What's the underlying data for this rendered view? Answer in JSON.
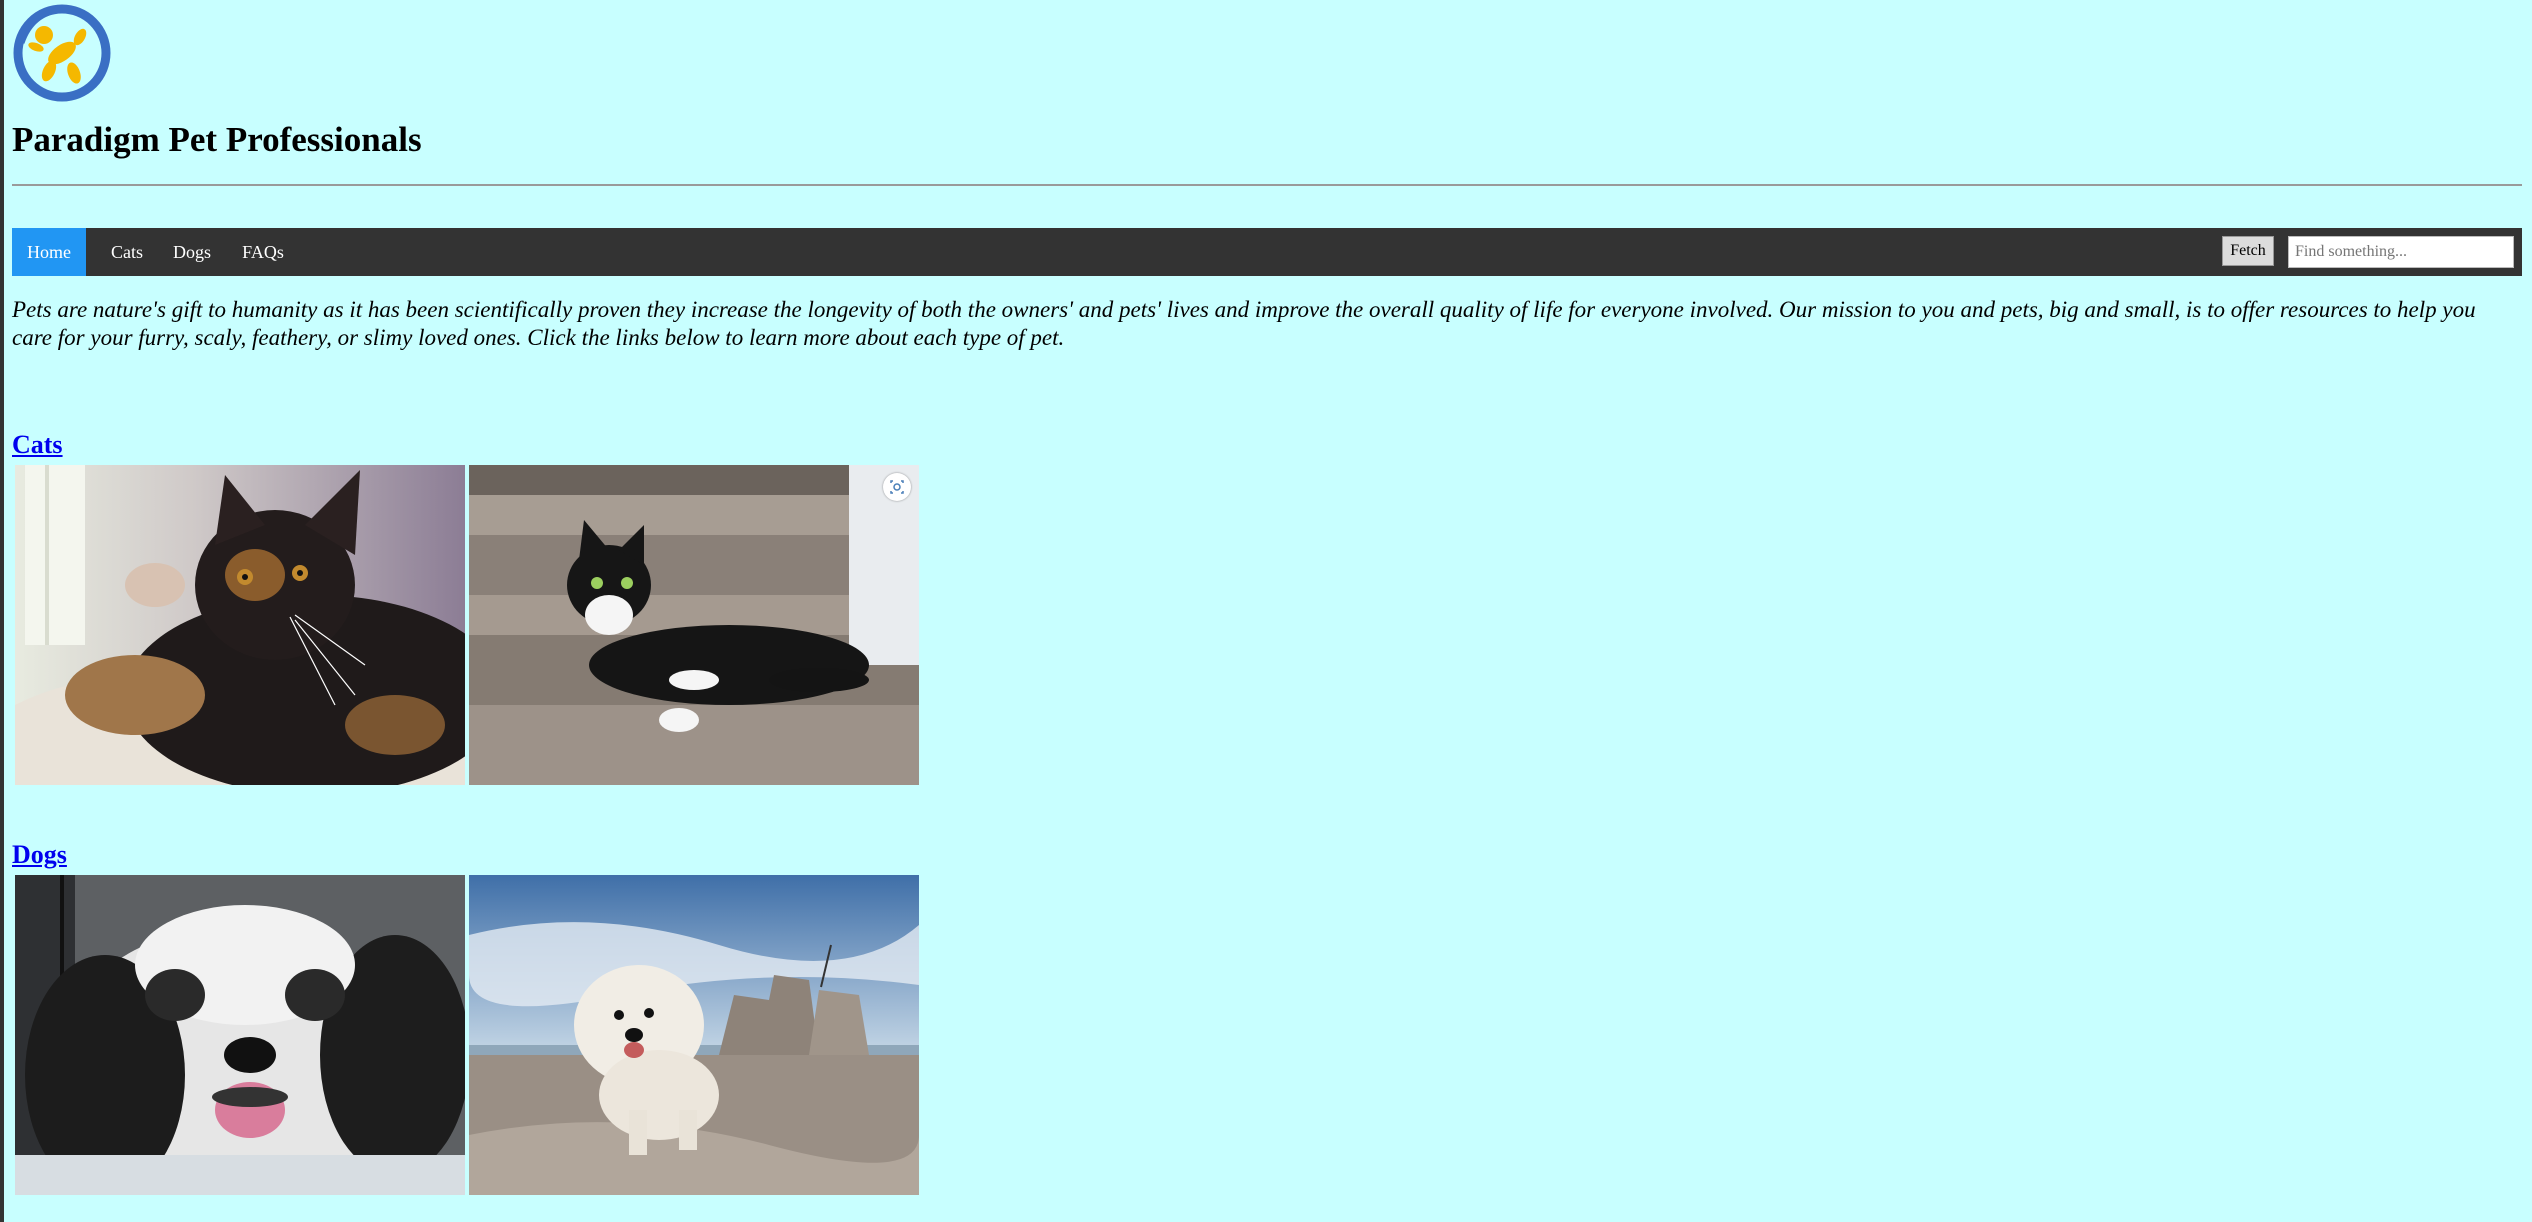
{
  "site": {
    "title": "Paradigm Pet Professionals"
  },
  "nav": {
    "items": [
      "Home",
      "Cats",
      "Dogs",
      "FAQs"
    ],
    "active": "Home",
    "fetch_label": "Fetch",
    "search_placeholder": "Find something..."
  },
  "main": {
    "mission": "Pets are nature's gift to humanity as it has been scientifically proven they increase the longevity of both the owners' and pets' lives and improve the overall quality of life for everyone involved. Our mission to you and pets, big and small, is to offer resources to help you care for your furry, scaly, feathery, or slimy loved ones. Click the links below to learn more about each type of pet.",
    "sections": [
      {
        "label": "Cats"
      },
      {
        "label": "Dogs"
      }
    ]
  },
  "colors": {
    "background": "#c8ffff",
    "nav_background": "#333333",
    "nav_active": "#2196f3",
    "link": "#0000ee",
    "logo_blue": "#3a6fc4",
    "logo_yellow": "#f5b800"
  },
  "icons": {
    "logo": "balloon-dog-logo",
    "lens": "visual-search-icon"
  }
}
